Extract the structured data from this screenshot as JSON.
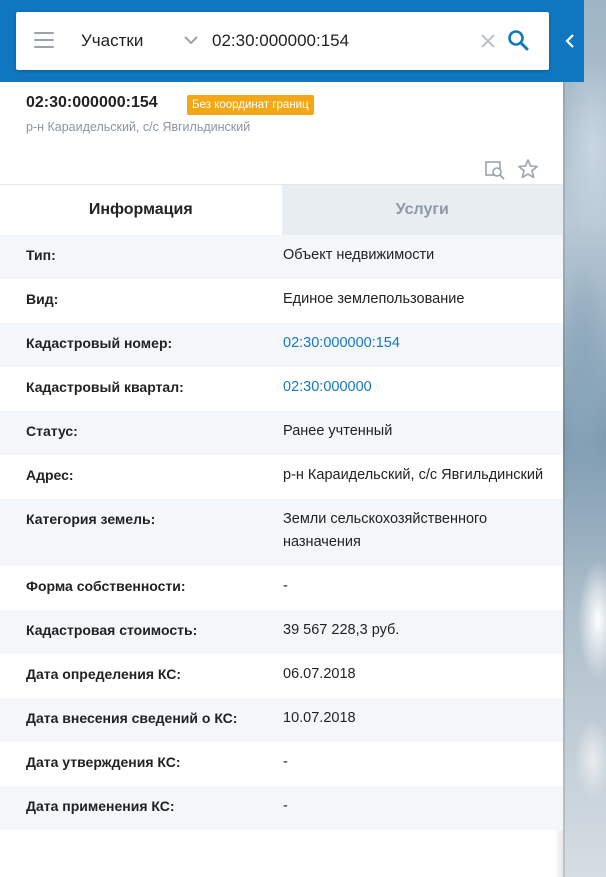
{
  "search": {
    "category": "Участки",
    "query": "02:30:000000:154"
  },
  "object": {
    "number": "02:30:000000:154",
    "badge": "Без координат границ",
    "address": "р-н Караидельский, с/с Явгильдинский"
  },
  "tabs": [
    {
      "label": "Информация",
      "active": true
    },
    {
      "label": "Услуги",
      "active": false
    }
  ],
  "info_rows": [
    {
      "label": "Тип:",
      "value": "Объект недвижимости",
      "link": false
    },
    {
      "label": "Вид:",
      "value": "Единое землепользование",
      "link": false
    },
    {
      "label": "Кадастровый номер:",
      "value": "02:30:000000:154",
      "link": true
    },
    {
      "label": "Кадастровый квартал:",
      "value": "02:30:000000",
      "link": true
    },
    {
      "label": "Статус:",
      "value": "Ранее учтенный",
      "link": false
    },
    {
      "label": "Адрес:",
      "value": "р-н Караидельский, с/с Явгильдинский",
      "link": false
    },
    {
      "label": "Категория земель:",
      "value": "Земли сельскохозяйственного назначения",
      "link": false
    },
    {
      "label": "Форма собственности:",
      "value": "-",
      "link": false
    },
    {
      "label": "Кадастровая стоимость:",
      "value": "39 567 228,3 руб.",
      "link": false
    },
    {
      "label": "Дата определения КС:",
      "value": "06.07.2018",
      "link": false
    },
    {
      "label": "Дата внесения сведений о КС:",
      "value": "10.07.2018",
      "link": false
    },
    {
      "label": "Дата утверждения КС:",
      "value": "-",
      "link": false
    },
    {
      "label": "Дата применения КС:",
      "value": "-",
      "link": false
    }
  ],
  "colors": {
    "header_blue": "#0f76c0",
    "badge_orange": "#f3a714",
    "link_blue": "#1678bd"
  }
}
